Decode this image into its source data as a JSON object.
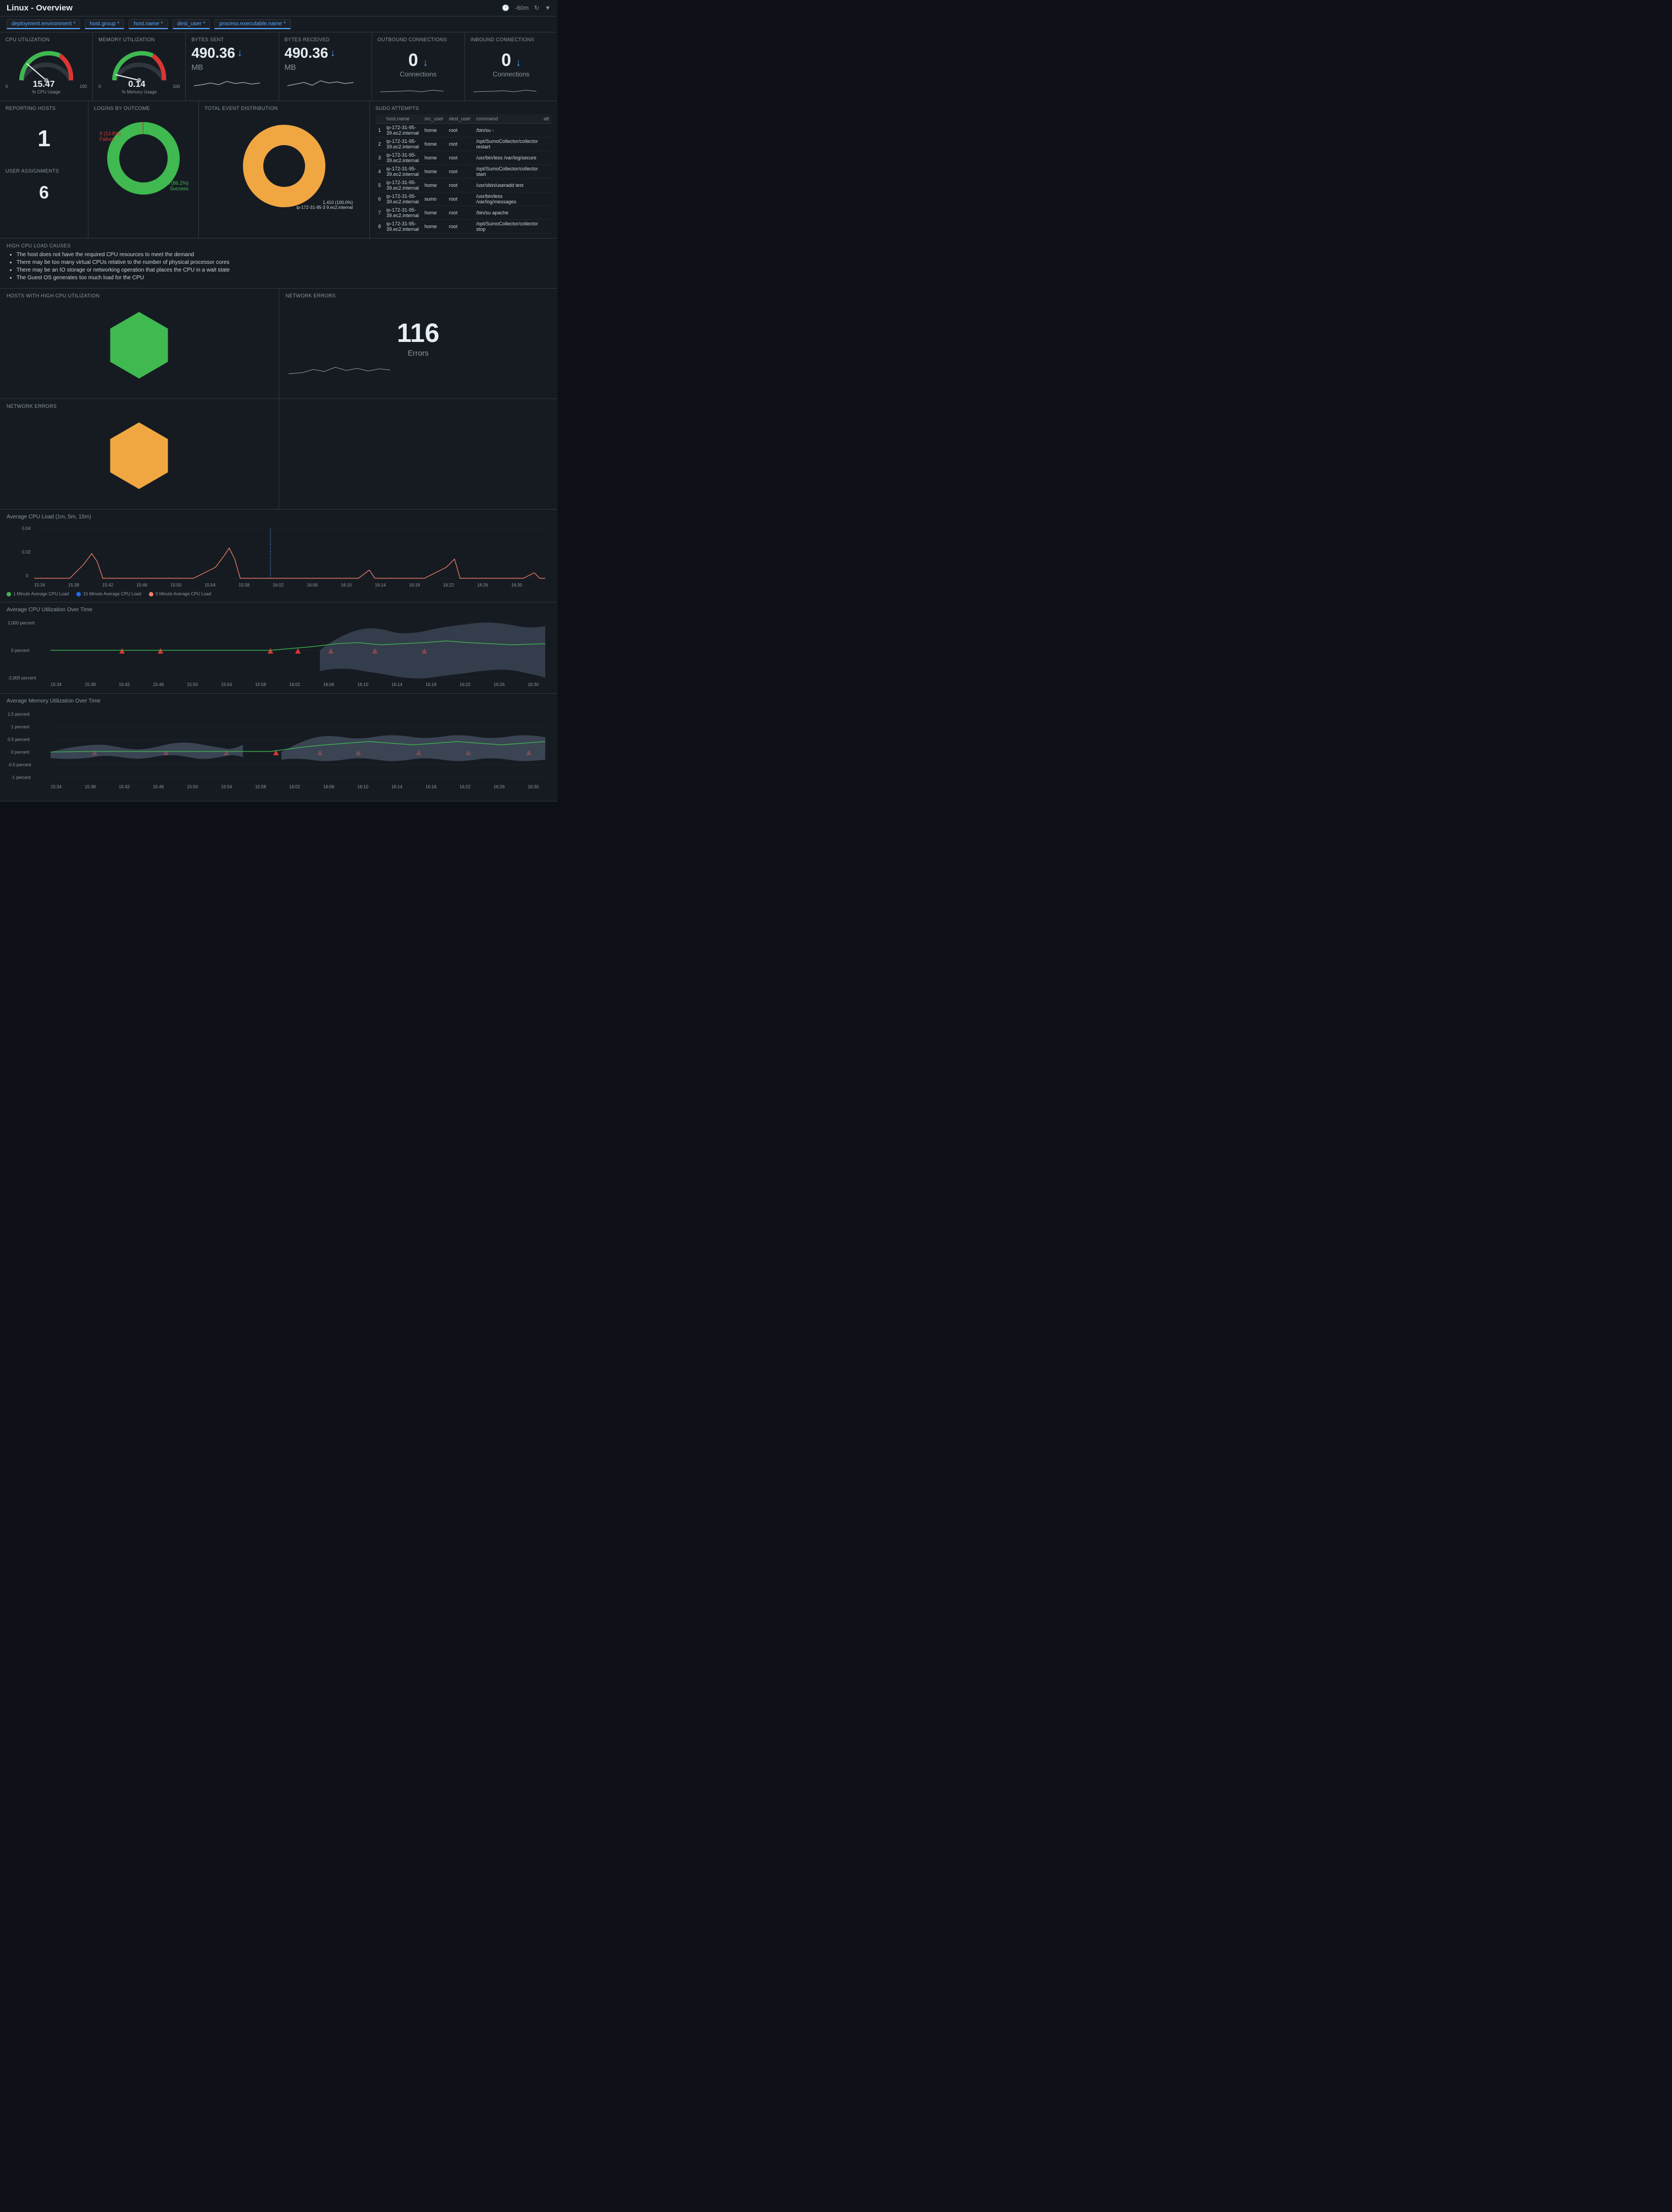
{
  "header": {
    "title": "Linux - Overview",
    "time_range": "-60m",
    "filters": [
      "deployment.environment *",
      "host.group *",
      "host.name *",
      "dest_user *",
      "process.executable.name *"
    ]
  },
  "metrics": {
    "cpu": {
      "label": "CPU Utilization",
      "value": "15.47",
      "min": "0",
      "max": "100",
      "unit": "% CPU Usage"
    },
    "memory": {
      "label": "Memory Utilization",
      "value": "0.14",
      "min": "0",
      "max": "100",
      "unit": "% Memory Usage"
    },
    "bytes_sent": {
      "label": "Bytes Sent",
      "value": "490.36",
      "unit": "MB"
    },
    "bytes_received": {
      "label": "Bytes Received",
      "value": "490.36",
      "unit": "MB"
    },
    "outbound": {
      "label": "Outbound Connections",
      "value": "0",
      "unit": "Connections"
    },
    "inbound": {
      "label": "Inbound Connections",
      "value": "0",
      "unit": "Connections"
    }
  },
  "reporting_hosts": {
    "label": "Reporting Hosts",
    "value": "1"
  },
  "user_assignments": {
    "label": "User Assignments",
    "value": "6"
  },
  "logins": {
    "label": "Logins by Outcome",
    "failure_count": "9",
    "failure_pct": "13.8%",
    "success_count": "56",
    "success_pct": "86.2%",
    "failure_label": "Failure",
    "success_label": "Success"
  },
  "total_event": {
    "label": "Total Event Distribution",
    "value": "1,410 (100.0%)",
    "host": "ip-172-31-95-3 9.ec2.internal"
  },
  "sudo": {
    "label": "Sudo Attempts",
    "columns": [
      "host.name",
      "src_user",
      "dest_user",
      "command",
      "att"
    ],
    "rows": [
      [
        "ip-172-31-95-39.ec2.internal",
        "home",
        "root",
        "/bin/su -",
        ""
      ],
      [
        "ip-172-31-95-39.ec2.internal",
        "home",
        "root",
        "/opt/SumoCollector/collector restart",
        ""
      ],
      [
        "ip-172-31-95-39.ec2.internal",
        "home",
        "root",
        "/usr/bin/less /var/log/secure",
        ""
      ],
      [
        "ip-172-31-95-39.ec2.internal",
        "home",
        "root",
        "/opt/SumoCollector/collector start",
        ""
      ],
      [
        "ip-172-31-95-39.ec2.internal",
        "home",
        "root",
        "/usr/sbin/useradd test",
        ""
      ],
      [
        "ip-172-31-95-39.ec2.internal",
        "sumo",
        "root",
        "/usr/bin/less /var/log/messages",
        ""
      ],
      [
        "ip-172-31-95-39.ec2.internal",
        "home",
        "root",
        "/bin/su apache",
        ""
      ],
      [
        "ip-172-31-95-39.ec2.internal",
        "home",
        "root",
        "/opt/SumoCollector/collector stop",
        ""
      ]
    ]
  },
  "cpu_causes": {
    "label": "High CPU Load Causes",
    "items": [
      "The host does not have the required CPU resources to meet the demand",
      "There may be too many virtual CPUs relative to the number of physical processor cores",
      "There may be an IO storage or networking operation that places the CPU in a wait state",
      "The Guest OS generates too much load for the CPU"
    ]
  },
  "hosts_high_cpu": {
    "label": "Hosts with High CPU Utilization"
  },
  "network_errors_left": {
    "label": "Network Errors"
  },
  "network_errors_right": {
    "label": "Network Errors",
    "value": "116",
    "unit": "Errors"
  },
  "avg_cpu_load": {
    "label": "Average CPU Load (1m, 5m, 15m)",
    "y_max": "0.04",
    "y_mid": "0.02",
    "y_min": "0",
    "times": [
      "15:34",
      "15:38",
      "15:42",
      "15:46",
      "15:50",
      "15:54",
      "15:58",
      "16:02",
      "16:06",
      "16:10",
      "16:14",
      "16:18",
      "16:22",
      "16:26",
      "16:30"
    ],
    "legend": [
      {
        "label": "1 Minute Average CPU Load",
        "color": "#3fb950"
      },
      {
        "label": "15 Minute Average CPU Load",
        "color": "#1f6feb"
      },
      {
        "label": "5 Minute Average CPU Load",
        "color": "#f78166"
      }
    ]
  },
  "avg_cpu_util": {
    "label": "Average CPU Utilization Over Time",
    "y_labels": [
      "2,000 percent",
      "0 percent",
      "-2,000 percent"
    ],
    "times": [
      "15:34",
      "15:38",
      "15:42",
      "15:46",
      "15:50",
      "15:54",
      "15:58",
      "16:02",
      "16:06",
      "16:10",
      "16:14",
      "16:18",
      "16:22",
      "16:26",
      "16:30"
    ]
  },
  "avg_mem_util": {
    "label": "Average Memory Utilization Over Time",
    "y_labels": [
      "1.5 percent",
      "1 percent",
      "0.5 percent",
      "0 percent",
      "-0.5 percent",
      "-1 percent"
    ],
    "times": [
      "15:34",
      "15:38",
      "15:42",
      "15:46",
      "15:50",
      "15:54",
      "15:58",
      "16:02",
      "16:06",
      "16:10",
      "16:14",
      "16:18",
      "16:22",
      "16:26",
      "16:30"
    ]
  }
}
